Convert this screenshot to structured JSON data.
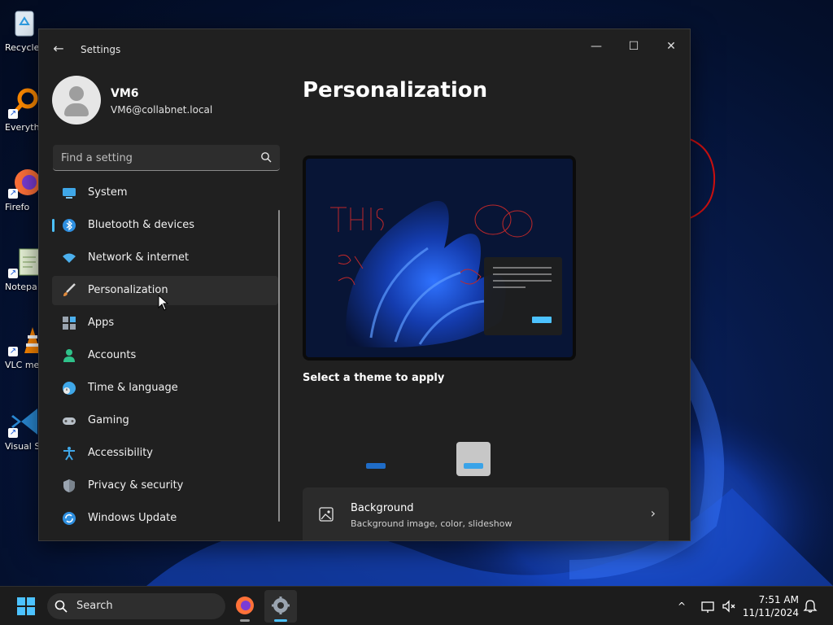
{
  "desktop": {
    "icons": [
      {
        "label": "Recycle",
        "icon": "recycle-bin-icon"
      },
      {
        "label": "Everyth",
        "icon": "everything-search-icon"
      },
      {
        "label": "Firefo",
        "icon": "firefox-icon"
      },
      {
        "label": "Notepa",
        "icon": "notepad-icon"
      },
      {
        "label": "VLC me playe",
        "icon": "vlc-icon"
      },
      {
        "label": "Visual St Cod",
        "icon": "vscode-icon"
      }
    ]
  },
  "window": {
    "title": "Settings",
    "controls": {
      "minimize": "—",
      "maximize": "☐",
      "close": "✕"
    }
  },
  "profile": {
    "name": "VM6",
    "email": "VM6@collabnet.local"
  },
  "search": {
    "placeholder": "Find a setting"
  },
  "nav": {
    "items": [
      {
        "label": "System",
        "icon": "system-icon"
      },
      {
        "label": "Bluetooth & devices",
        "icon": "bluetooth-icon"
      },
      {
        "label": "Network & internet",
        "icon": "wifi-icon"
      },
      {
        "label": "Personalization",
        "icon": "brush-icon",
        "selected": true
      },
      {
        "label": "Apps",
        "icon": "apps-icon"
      },
      {
        "label": "Accounts",
        "icon": "accounts-icon"
      },
      {
        "label": "Time & language",
        "icon": "time-language-icon"
      },
      {
        "label": "Gaming",
        "icon": "gaming-icon"
      },
      {
        "label": "Accessibility",
        "icon": "accessibility-icon"
      },
      {
        "label": "Privacy & security",
        "icon": "shield-icon"
      },
      {
        "label": "Windows Update",
        "icon": "windows-update-icon"
      }
    ]
  },
  "main": {
    "title": "Personalization",
    "preview_caption": "Select a theme to apply",
    "background": {
      "title": "Background",
      "subtitle": "Background image, color, slideshow"
    }
  },
  "taskbar": {
    "search_label": "Search",
    "time": "7:51 AM",
    "date": "11/11/2024"
  },
  "colors": {
    "accent": "#4cc2ff",
    "window_bg": "#202020",
    "taskbar_bg": "#1c1c1c"
  }
}
